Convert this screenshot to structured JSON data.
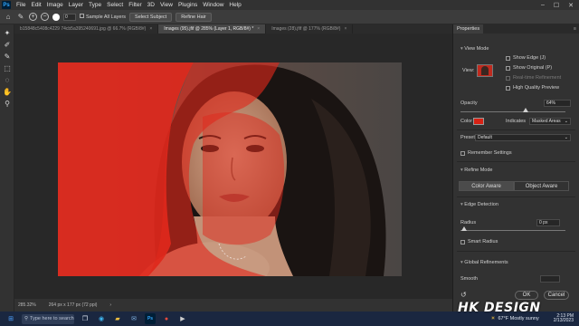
{
  "menubar": {
    "logo": "Ps",
    "items": [
      "File",
      "Edit",
      "Image",
      "Layer",
      "Type",
      "Select",
      "Filter",
      "3D",
      "View",
      "Plugins",
      "Window",
      "Help"
    ],
    "window_controls": [
      "–",
      "☐",
      "✕"
    ]
  },
  "options": {
    "brush_size": "0",
    "sample_all_layers": "Sample All Layers",
    "select_subject": "Select Subject",
    "refine_hair": "Refine Hair"
  },
  "tabs": [
    {
      "label": "b15848c5408c4229 74cb5a395240691.jpg @ 66.7% (RGB/8#)",
      "active": false
    },
    {
      "label": "Images (95).jfif @ 285% (Layer 1, RGB/8#) *",
      "active": true
    },
    {
      "label": "Images (28).jfif @ 177% (RGB/8#)",
      "active": false
    }
  ],
  "status": {
    "zoom": "285.32%",
    "dimensions": "264 px x 177 px (72 ppi)"
  },
  "properties": {
    "tab": "Properties",
    "view_mode": "View Mode",
    "view_label": "View:",
    "show_edge": "Show Edge (J)",
    "show_original": "Show Original (P)",
    "real_time_refinement": "Real-time Refinement",
    "high_quality_preview": "High Quality Preview",
    "opacity_label": "Opacity",
    "opacity_value": "64%",
    "color_label": "Color",
    "color_value": "#d82215",
    "indicates_label": "Indicates",
    "indicates_value": "Masked Areas",
    "preset_label": "Preset",
    "preset_value": "Default",
    "remember_settings": "Remember Settings",
    "refine_mode": "Refine Mode",
    "color_aware": "Color Aware",
    "object_aware": "Object Aware",
    "edge_detection": "Edge Detection",
    "radius_label": "Radius",
    "radius_value": "0 px",
    "smart_radius": "Smart Radius",
    "global_refinements": "Global Refinements",
    "smooth_label": "Smooth",
    "ok": "OK",
    "cancel": "Cancel"
  },
  "taskbar": {
    "search_placeholder": "Type here to search",
    "weather": "67°F  Mostly sunny",
    "time": "2:13 PM",
    "date": "2/13/2023"
  },
  "watermark": "HK DESIGN",
  "colors": {
    "mask_red": "#e0281c",
    "accent_blue": "#31a8ff"
  }
}
